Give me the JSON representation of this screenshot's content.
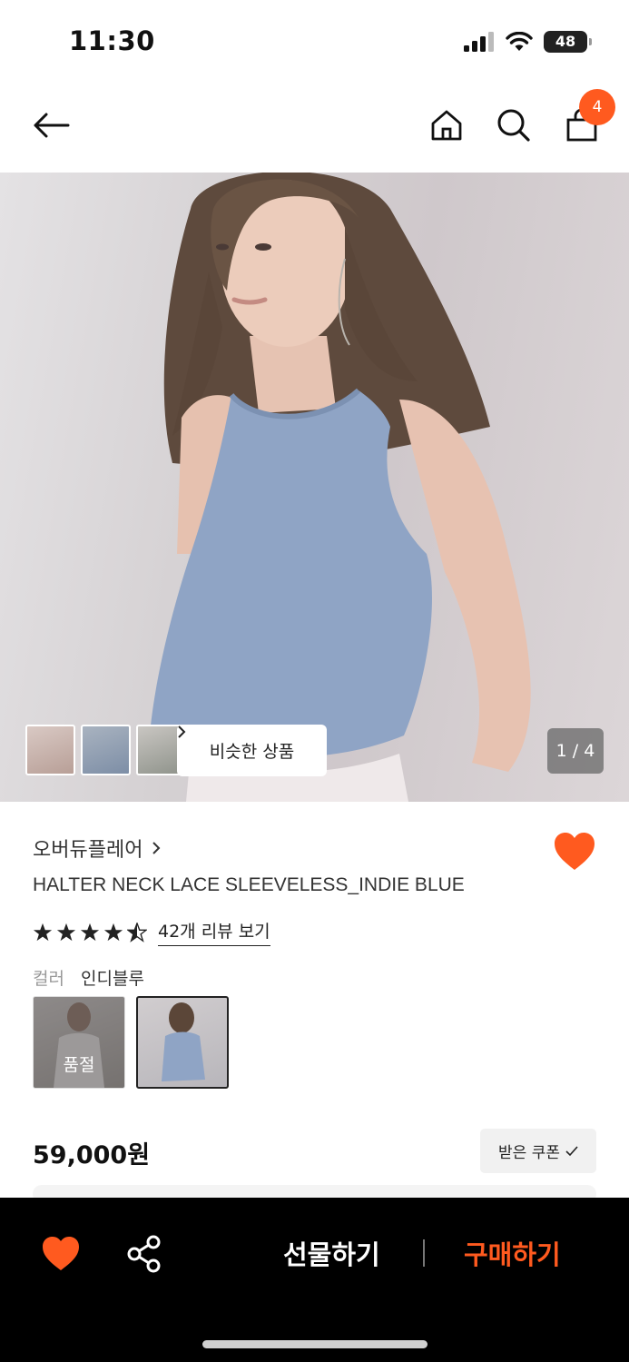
{
  "status_bar": {
    "time": "11:30",
    "battery": "48"
  },
  "nav": {
    "cart_count": "4"
  },
  "gallery": {
    "similar_label": "비슷한 상품",
    "page_indicator": "1 / 4"
  },
  "product": {
    "brand": "오버듀플레어",
    "name": "HALTER NECK LACE SLEEVELESS_INDIE BLUE",
    "rating": 4.5,
    "review_link": "42개 리뷰 보기",
    "color_label": "컬러",
    "color_value": "인디블루",
    "soldout_label": "품절",
    "price": "59,000원",
    "coupon_label": "받은 쿠폰"
  },
  "bottom_bar": {
    "gift_label": "선물하기",
    "buy_label": "구매하기"
  },
  "colors": {
    "accent": "#ff5a1f",
    "bottom_bar_bg": "#000000"
  }
}
